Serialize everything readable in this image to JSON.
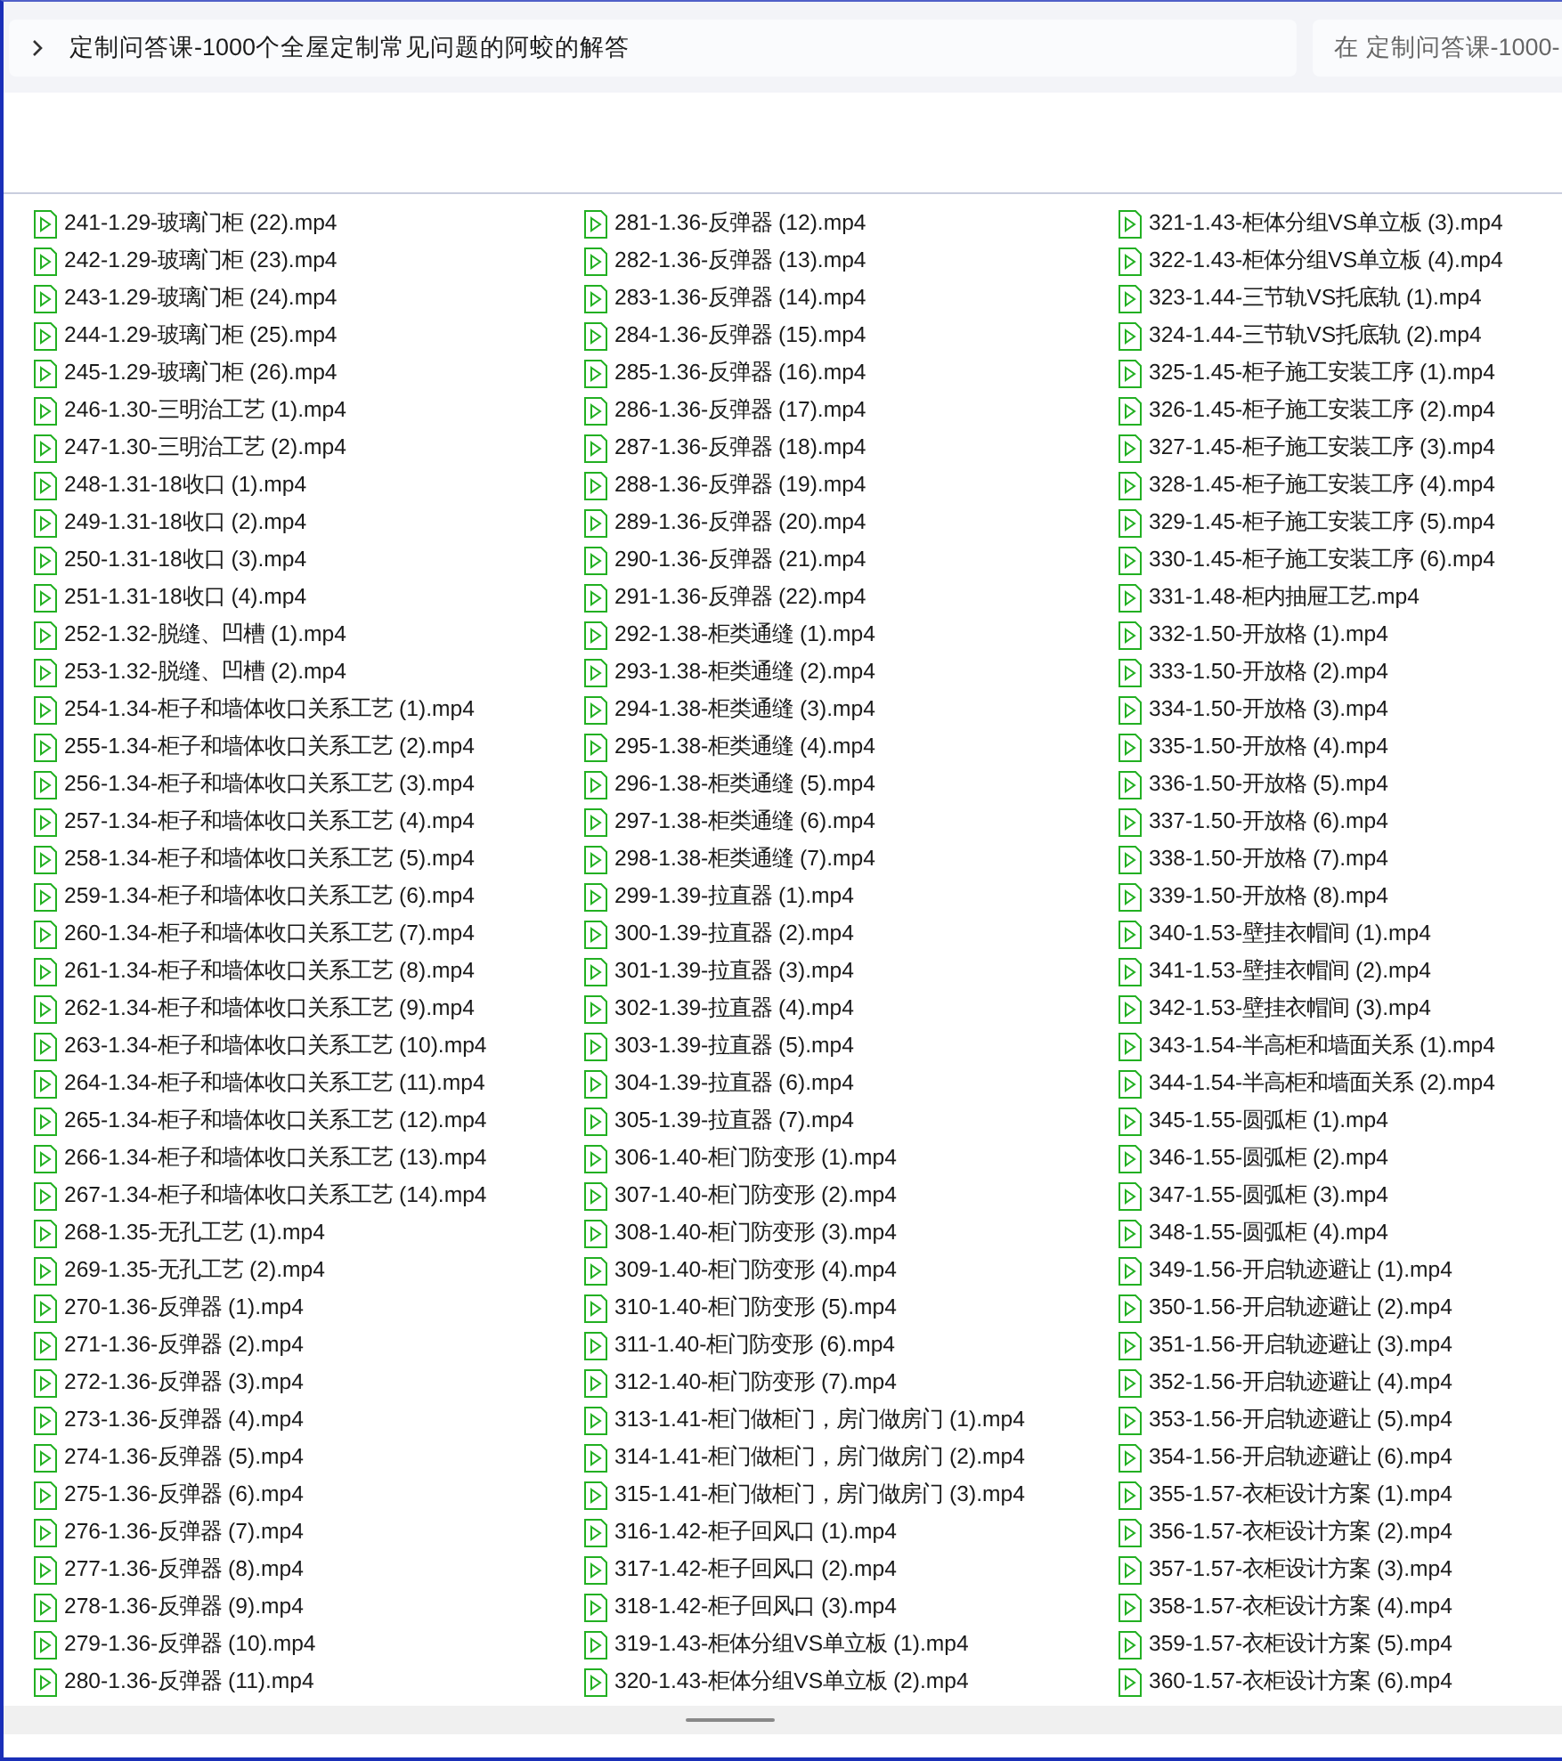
{
  "address_bar": {
    "path": "定制问答课-1000个全屋定制常见问题的阿蛟的解答"
  },
  "search": {
    "placeholder": "在 定制问答课-1000-"
  },
  "files": [
    "241-1.29-玻璃门柜 (22).mp4",
    "242-1.29-玻璃门柜 (23).mp4",
    "243-1.29-玻璃门柜 (24).mp4",
    "244-1.29-玻璃门柜 (25).mp4",
    "245-1.29-玻璃门柜 (26).mp4",
    "246-1.30-三明治工艺 (1).mp4",
    "247-1.30-三明治工艺 (2).mp4",
    "248-1.31-18收口 (1).mp4",
    "249-1.31-18收口 (2).mp4",
    "250-1.31-18收口 (3).mp4",
    "251-1.31-18收口 (4).mp4",
    "252-1.32-脱缝、凹槽 (1).mp4",
    "253-1.32-脱缝、凹槽 (2).mp4",
    "254-1.34-柜子和墙体收口关系工艺 (1).mp4",
    "255-1.34-柜子和墙体收口关系工艺 (2).mp4",
    "256-1.34-柜子和墙体收口关系工艺 (3).mp4",
    "257-1.34-柜子和墙体收口关系工艺 (4).mp4",
    "258-1.34-柜子和墙体收口关系工艺 (5).mp4",
    "259-1.34-柜子和墙体收口关系工艺 (6).mp4",
    "260-1.34-柜子和墙体收口关系工艺 (7).mp4",
    "261-1.34-柜子和墙体收口关系工艺 (8).mp4",
    "262-1.34-柜子和墙体收口关系工艺 (9).mp4",
    "263-1.34-柜子和墙体收口关系工艺 (10).mp4",
    "264-1.34-柜子和墙体收口关系工艺 (11).mp4",
    "265-1.34-柜子和墙体收口关系工艺 (12).mp4",
    "266-1.34-柜子和墙体收口关系工艺 (13).mp4",
    "267-1.34-柜子和墙体收口关系工艺 (14).mp4",
    "268-1.35-无孔工艺 (1).mp4",
    "269-1.35-无孔工艺 (2).mp4",
    "270-1.36-反弹器 (1).mp4",
    "271-1.36-反弹器 (2).mp4",
    "272-1.36-反弹器 (3).mp4",
    "273-1.36-反弹器 (4).mp4",
    "274-1.36-反弹器 (5).mp4",
    "275-1.36-反弹器 (6).mp4",
    "276-1.36-反弹器 (7).mp4",
    "277-1.36-反弹器 (8).mp4",
    "278-1.36-反弹器 (9).mp4",
    "279-1.36-反弹器 (10).mp4",
    "280-1.36-反弹器 (11).mp4",
    "281-1.36-反弹器 (12).mp4",
    "282-1.36-反弹器 (13).mp4",
    "283-1.36-反弹器 (14).mp4",
    "284-1.36-反弹器 (15).mp4",
    "285-1.36-反弹器 (16).mp4",
    "286-1.36-反弹器 (17).mp4",
    "287-1.36-反弹器 (18).mp4",
    "288-1.36-反弹器 (19).mp4",
    "289-1.36-反弹器 (20).mp4",
    "290-1.36-反弹器 (21).mp4",
    "291-1.36-反弹器 (22).mp4",
    "292-1.38-柜类通缝 (1).mp4",
    "293-1.38-柜类通缝 (2).mp4",
    "294-1.38-柜类通缝 (3).mp4",
    "295-1.38-柜类通缝 (4).mp4",
    "296-1.38-柜类通缝 (5).mp4",
    "297-1.38-柜类通缝 (6).mp4",
    "298-1.38-柜类通缝 (7).mp4",
    "299-1.39-拉直器 (1).mp4",
    "300-1.39-拉直器 (2).mp4",
    "301-1.39-拉直器 (3).mp4",
    "302-1.39-拉直器 (4).mp4",
    "303-1.39-拉直器 (5).mp4",
    "304-1.39-拉直器 (6).mp4",
    "305-1.39-拉直器 (7).mp4",
    "306-1.40-柜门防变形 (1).mp4",
    "307-1.40-柜门防变形 (2).mp4",
    "308-1.40-柜门防变形 (3).mp4",
    "309-1.40-柜门防变形 (4).mp4",
    "310-1.40-柜门防变形 (5).mp4",
    "311-1.40-柜门防变形 (6).mp4",
    "312-1.40-柜门防变形 (7).mp4",
    "313-1.41-柜门做柜门，房门做房门 (1).mp4",
    "314-1.41-柜门做柜门，房门做房门 (2).mp4",
    "315-1.41-柜门做柜门，房门做房门 (3).mp4",
    "316-1.42-柜子回风口 (1).mp4",
    "317-1.42-柜子回风口 (2).mp4",
    "318-1.42-柜子回风口 (3).mp4",
    "319-1.43-柜体分组VS单立板 (1).mp4",
    "320-1.43-柜体分组VS单立板 (2).mp4",
    "321-1.43-柜体分组VS单立板 (3).mp4",
    "322-1.43-柜体分组VS单立板 (4).mp4",
    "323-1.44-三节轨VS托底轨 (1).mp4",
    "324-1.44-三节轨VS托底轨 (2).mp4",
    "325-1.45-柜子施工安装工序 (1).mp4",
    "326-1.45-柜子施工安装工序 (2).mp4",
    "327-1.45-柜子施工安装工序 (3).mp4",
    "328-1.45-柜子施工安装工序 (4).mp4",
    "329-1.45-柜子施工安装工序 (5).mp4",
    "330-1.45-柜子施工安装工序 (6).mp4",
    "331-1.48-柜内抽屉工艺.mp4",
    "332-1.50-开放格 (1).mp4",
    "333-1.50-开放格 (2).mp4",
    "334-1.50-开放格 (3).mp4",
    "335-1.50-开放格 (4).mp4",
    "336-1.50-开放格 (5).mp4",
    "337-1.50-开放格 (6).mp4",
    "338-1.50-开放格 (7).mp4",
    "339-1.50-开放格 (8).mp4",
    "340-1.53-壁挂衣帽间 (1).mp4",
    "341-1.53-壁挂衣帽间 (2).mp4",
    "342-1.53-壁挂衣帽间 (3).mp4",
    "343-1.54-半高柜和墙面关系 (1).mp4",
    "344-1.54-半高柜和墙面关系 (2).mp4",
    "345-1.55-圆弧柜 (1).mp4",
    "346-1.55-圆弧柜 (2).mp4",
    "347-1.55-圆弧柜 (3).mp4",
    "348-1.55-圆弧柜 (4).mp4",
    "349-1.56-开启轨迹避让 (1).mp4",
    "350-1.56-开启轨迹避让 (2).mp4",
    "351-1.56-开启轨迹避让 (3).mp4",
    "352-1.56-开启轨迹避让 (4).mp4",
    "353-1.56-开启轨迹避让 (5).mp4",
    "354-1.56-开启轨迹避让 (6).mp4",
    "355-1.57-衣柜设计方案 (1).mp4",
    "356-1.57-衣柜设计方案 (2).mp4",
    "357-1.57-衣柜设计方案 (3).mp4",
    "358-1.57-衣柜设计方案 (4).mp4",
    "359-1.57-衣柜设计方案 (5).mp4",
    "360-1.57-衣柜设计方案 (6).mp4"
  ]
}
